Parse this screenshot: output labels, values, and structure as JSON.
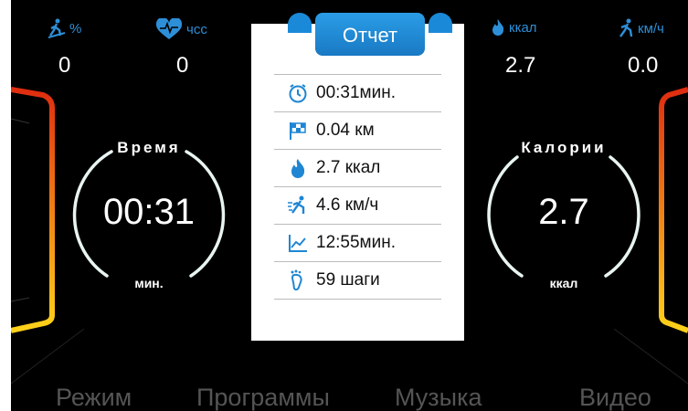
{
  "top_stats": [
    {
      "icon": "runner-incline-icon",
      "label": "%",
      "value": "0"
    },
    {
      "icon": "heart-rate-icon",
      "label": "чсс",
      "value": "0"
    },
    {
      "icon": "calorie-flame-icon",
      "label": "ккал",
      "value": "2.7"
    },
    {
      "icon": "speed-runner-icon",
      "label": "км/ч",
      "value": "0.0"
    }
  ],
  "dials": {
    "time": {
      "title": "Время",
      "value": "00:31",
      "unit": "мин."
    },
    "calories": {
      "title": "Калории",
      "value": "2.7",
      "unit": "ккал"
    }
  },
  "modal": {
    "title": "Отчет",
    "rows": [
      {
        "icon": "clock-icon",
        "text": "00:31мин."
      },
      {
        "icon": "finish-flag-icon",
        "text": "0.04 км"
      },
      {
        "icon": "flame-icon",
        "text": "2.7 ккал"
      },
      {
        "icon": "runner-icon",
        "text": "4.6 км/ч"
      },
      {
        "icon": "pace-chart-icon",
        "text": "12:55мин."
      },
      {
        "icon": "footprint-icon",
        "text": "59 шаги"
      }
    ]
  },
  "tabs": [
    "Режим",
    "Программы",
    "Музыка",
    "Видео"
  ],
  "colors": {
    "accent": "#2d8fd8",
    "dial_ring": "#e8f4f1",
    "modal_header": "#1f86d3",
    "background": "#000000"
  }
}
